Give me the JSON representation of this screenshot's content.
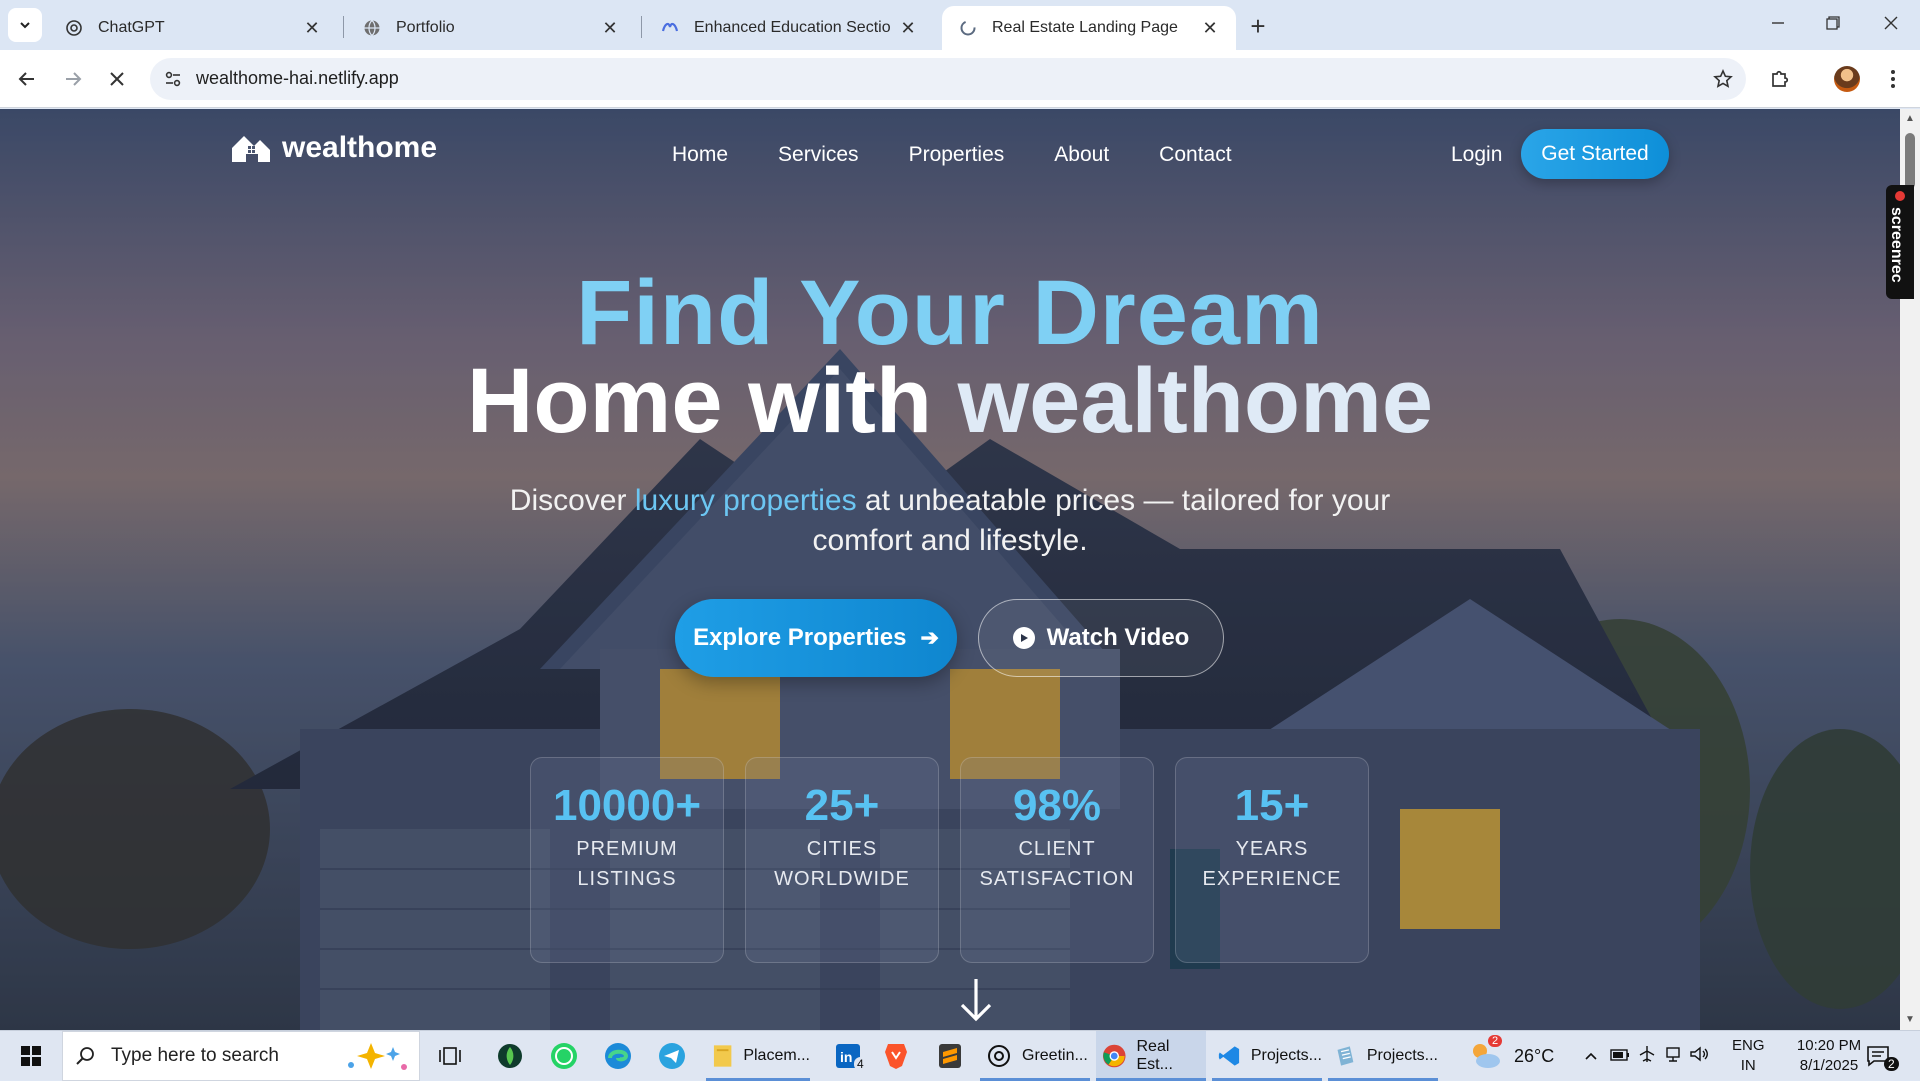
{
  "browser": {
    "tabs": [
      {
        "title": "ChatGPT",
        "icon": "chatgpt-icon",
        "active": false
      },
      {
        "title": "Portfolio",
        "icon": "globe-icon",
        "active": false
      },
      {
        "title": "Enhanced Education Section De",
        "icon": "copilot-icon",
        "active": false
      },
      {
        "title": "Real Estate Landing Page",
        "icon": "loading-icon",
        "active": true
      }
    ],
    "url": "wealthome-hai.netlify.app"
  },
  "site": {
    "brand": "wealthome",
    "nav": [
      "Home",
      "Services",
      "Properties",
      "About",
      "Contact"
    ],
    "login": "Login",
    "cta": "Get Started",
    "hero": {
      "line1": "Find Your Dream",
      "line2_prefix": "Home with ",
      "line2_brand": "wealthome",
      "sub_before": "Discover ",
      "sub_accent": "luxury properties",
      "sub_after": " at unbeatable prices — tailored for your comfort and lifestyle.",
      "primary_btn": "Explore Properties",
      "secondary_btn": "Watch Video"
    },
    "stats": [
      {
        "value": "10000+",
        "label": "PREMIUM LISTINGS"
      },
      {
        "value": "25+",
        "label": "CITIES WORLDWIDE"
      },
      {
        "value": "98%",
        "label": "CLIENT SATISFACTION"
      },
      {
        "value": "15+",
        "label": "YEARS EXPERIENCE"
      }
    ],
    "colors": {
      "accent": "#1f9ee6",
      "highlight": "#7fd0f4"
    }
  },
  "screenrec": "screenrec",
  "taskbar": {
    "search_placeholder": "Type here to search",
    "apps": [
      {
        "label": "Placem...",
        "icon": "file-explorer-icon"
      },
      {
        "label": "Greetin...",
        "icon": "chatgpt-icon"
      },
      {
        "label": "Real Est...",
        "icon": "chrome-icon"
      },
      {
        "label": "Projects...",
        "icon": "vscode-icon"
      },
      {
        "label": "Projects...",
        "icon": "notepad-icon"
      }
    ],
    "linkedin_badge": "4",
    "weather_badge": "2",
    "temperature": "26°C",
    "lang1": "ENG",
    "lang2": "IN",
    "time": "10:20 PM",
    "date": "8/1/2025",
    "notif_count": "2"
  }
}
